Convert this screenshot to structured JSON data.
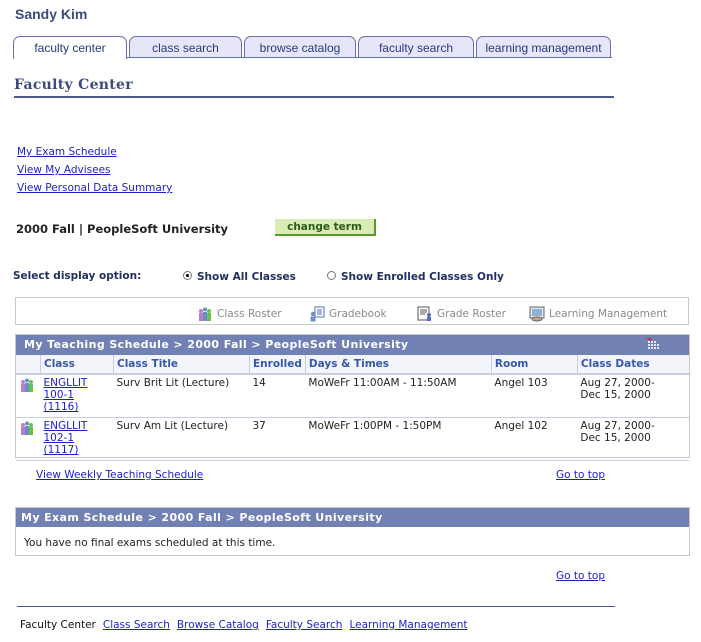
{
  "user_name": "Sandy Kim",
  "tabs": [
    {
      "label": "faculty center",
      "active": true
    },
    {
      "label": "class search",
      "active": false
    },
    {
      "label": "browse catalog",
      "active": false
    },
    {
      "label": "faculty search",
      "active": false
    },
    {
      "label": "learning management",
      "active": false
    }
  ],
  "page_title": "Faculty Center",
  "top_links": [
    "My Exam Schedule",
    "View My Advisees",
    "View Personal Data Summary"
  ],
  "term": {
    "label": "2000 Fall | PeopleSoft University",
    "change_button": "change term"
  },
  "display_option": {
    "label": "Select display option:",
    "options": [
      {
        "label": "Show All Classes",
        "selected": true
      },
      {
        "label": "Show Enrolled Classes Only",
        "selected": false
      }
    ]
  },
  "actions": [
    {
      "label": "Class Roster",
      "icon": "class-roster-icon"
    },
    {
      "label": "Gradebook",
      "icon": "gradebook-icon"
    },
    {
      "label": "Grade Roster",
      "icon": "grade-roster-icon"
    },
    {
      "label": "Learning Management",
      "icon": "learning-management-icon"
    }
  ],
  "teaching_schedule": {
    "header": "My Teaching Schedule > 2000 Fall > PeopleSoft University",
    "columns": [
      "",
      "Class",
      "Class Title",
      "Enrolled",
      "Days & Times",
      "Room",
      "Class Dates"
    ],
    "rows": [
      {
        "class_lines": [
          "ENGLLIT",
          "100-1",
          "(1116)"
        ],
        "title": "Surv Brit Lit (Lecture)",
        "enrolled": "14",
        "days_times": "MoWeFr 11:00AM - 11:50AM",
        "room": "Angel 103",
        "dates_lines": [
          "Aug 27, 2000-",
          "Dec 15, 2000"
        ]
      },
      {
        "class_lines": [
          "ENGLLIT",
          "102-1",
          "(1117)"
        ],
        "title": "Surv Am Lit (Lecture)",
        "enrolled": "37",
        "days_times": "MoWeFr 1:00PM - 1:50PM",
        "room": "Angel 102",
        "dates_lines": [
          "Aug 27, 2000-",
          "Dec 15, 2000"
        ]
      }
    ]
  },
  "weekly_link": "View Weekly Teaching Schedule",
  "go_to_top": "Go to top",
  "exam_schedule": {
    "header": "My Exam Schedule > 2000 Fall > PeopleSoft University",
    "message": "You have no final exams scheduled at this time."
  },
  "footer": {
    "current": "Faculty Center",
    "links": [
      "Class Search",
      "Browse Catalog",
      "Faculty Search",
      "Learning Management"
    ]
  },
  "colors": {
    "header_bar": "#7181b4",
    "link": "#1c1ec6",
    "title": "#3b4c7a",
    "button": "#d8ecb6"
  }
}
